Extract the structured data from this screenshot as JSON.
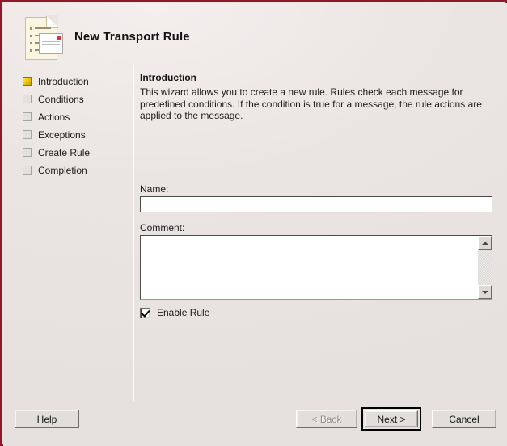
{
  "window": {
    "title": "New Transport Rule",
    "icon": "transport-rule-document-icon",
    "border_color": "#8b1a2b",
    "background_color": "#e9e3e1"
  },
  "sidebar": {
    "steps": [
      {
        "label": "Introduction",
        "state": "active"
      },
      {
        "label": "Conditions",
        "state": "pending"
      },
      {
        "label": "Actions",
        "state": "pending"
      },
      {
        "label": "Exceptions",
        "state": "pending"
      },
      {
        "label": "Create Rule",
        "state": "pending"
      },
      {
        "label": "Completion",
        "state": "pending"
      }
    ],
    "active_marker_color": "#e8c400"
  },
  "content": {
    "heading": "Introduction",
    "description": "This wizard allows you to create a new rule. Rules check each message for predefined conditions. If the condition is true for a message, the rule actions are applied to the message.",
    "name_label": "Name:",
    "name_value": "",
    "name_placeholder": "",
    "comment_label": "Comment:",
    "comment_value": "",
    "comment_placeholder": "",
    "enable_rule_label": "Enable Rule",
    "enable_rule_checked": true,
    "scrollbar": {
      "up_arrow": "scroll-up-arrow-icon",
      "down_arrow": "scroll-down-arrow-icon"
    }
  },
  "footer": {
    "help_label": "Help",
    "back_label": "< Back",
    "back_disabled": true,
    "next_label": "Next >",
    "next_is_default": true,
    "cancel_label": "Cancel"
  }
}
